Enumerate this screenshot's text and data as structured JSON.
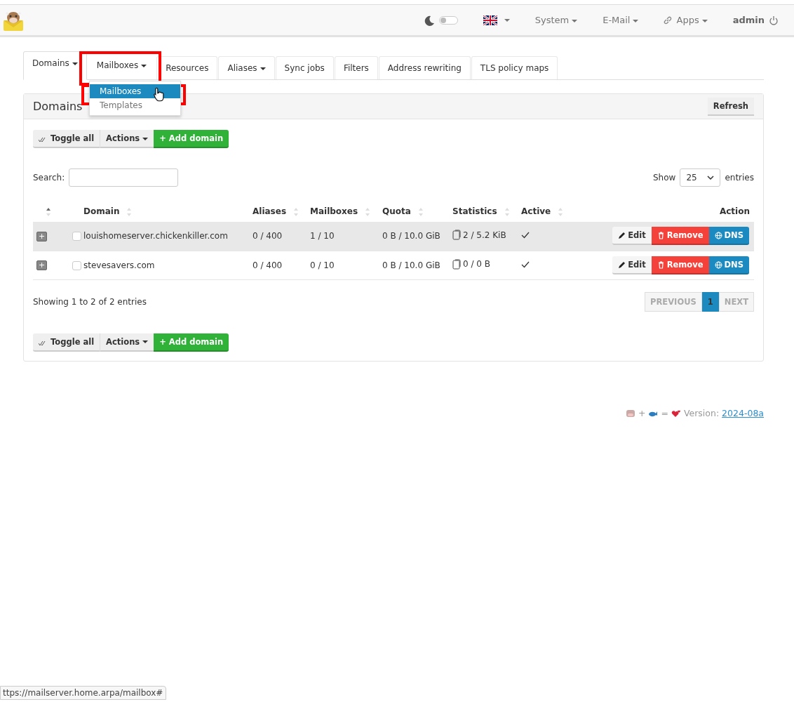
{
  "navbar": {
    "theme_toggle": {
      "on": false
    },
    "language": {
      "caret": true
    },
    "menus": [
      {
        "label": "System",
        "kind": "plain"
      },
      {
        "label": "E-Mail",
        "kind": "plain"
      },
      {
        "label": "Apps",
        "kind": "link"
      }
    ],
    "user": "admin"
  },
  "tabs": [
    {
      "label": "Domains",
      "dropdown": true,
      "selected": true,
      "highlighted": false
    },
    {
      "label": "Mailboxes",
      "dropdown": true,
      "selected": false,
      "highlighted": true
    },
    {
      "label": "Resources",
      "dropdown": false,
      "selected": false,
      "highlighted": false
    },
    {
      "label": "Aliases",
      "dropdown": true,
      "selected": false,
      "highlighted": false
    },
    {
      "label": "Sync jobs",
      "dropdown": false,
      "selected": false,
      "highlighted": false
    },
    {
      "label": "Filters",
      "dropdown": false,
      "selected": false,
      "highlighted": false
    },
    {
      "label": "Address rewriting",
      "dropdown": false,
      "selected": false,
      "highlighted": false
    },
    {
      "label": "TLS policy maps",
      "dropdown": false,
      "selected": false,
      "highlighted": false
    }
  ],
  "dropdown_menu": {
    "items": [
      {
        "label": "Mailboxes",
        "selected": true,
        "highlighted": true
      },
      {
        "label": "Templates",
        "selected": false,
        "highlighted": false
      }
    ]
  },
  "panel": {
    "title": "Domains",
    "refresh": "Refresh",
    "toolbar": {
      "toggle_all": "Toggle all",
      "actions": "Actions",
      "add": "+ Add domain"
    },
    "search_label": "Search:",
    "show_label": "Show",
    "page_size": "25",
    "entries_label": "entries",
    "table": {
      "columns": [
        {
          "sortable": true,
          "sorted": true
        },
        {
          "sortable": false
        },
        {
          "label": "Domain",
          "sortable": true,
          "sorted": false
        },
        {
          "label": "Aliases",
          "sortable": true,
          "sorted": false
        },
        {
          "label": "Mailboxes",
          "sortable": true,
          "sorted": false
        },
        {
          "label": "Quota",
          "sortable": true,
          "sorted": false
        },
        {
          "label": "Statistics",
          "sortable": true,
          "sorted": false
        },
        {
          "label": "Active",
          "sortable": true,
          "sorted": false
        },
        {
          "label": "Action",
          "sortable": false
        }
      ],
      "rows": [
        {
          "expand": "+",
          "checked": false,
          "hover": true,
          "domain": "louishomeserver.chickenkiller.com",
          "aliases": "0 / 400",
          "mailboxes": "1 / 10",
          "quota": "0 B / 10.0 GiB",
          "statistics": "2 / 5.2 KiB",
          "active": true,
          "actions": [
            "Edit",
            "Remove",
            "DNS"
          ]
        },
        {
          "expand": "+",
          "checked": false,
          "hover": false,
          "domain": "stevesavers.com",
          "aliases": "0 / 400",
          "mailboxes": "0 / 10",
          "quota": "0 B / 10.0 GiB",
          "statistics": "0 / 0 B",
          "active": true,
          "actions": [
            "Edit",
            "Remove",
            "DNS"
          ]
        }
      ]
    },
    "info": "Showing 1 to 2 of 2 entries",
    "pagination": [
      {
        "label": "PREVIOUS",
        "selected": false,
        "disabled": true
      },
      {
        "label": "1",
        "selected": true,
        "disabled": false
      },
      {
        "label": "NEXT",
        "selected": false,
        "disabled": true
      }
    ],
    "bottom_toolbar": {
      "toggle_all": "Toggle all",
      "actions": "Actions",
      "add": "+ Add domain"
    }
  },
  "footer": {
    "plus": "+",
    "equals": "=",
    "version_label": "Version:",
    "version": "2024-08a"
  },
  "status_url": "ttps://mailserver.home.arpa/mailbox#"
}
